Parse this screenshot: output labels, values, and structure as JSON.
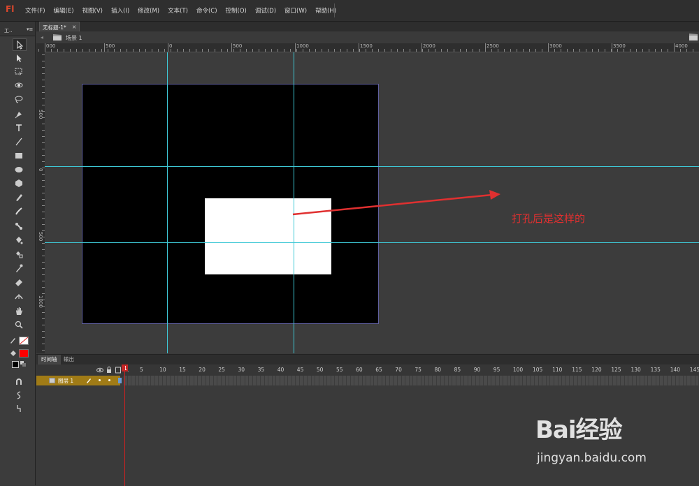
{
  "app": {
    "logo": "Fl"
  },
  "menu": [
    "文件(F)",
    "编辑(E)",
    "视图(V)",
    "插入(I)",
    "修改(M)",
    "文本(T)",
    "命令(C)",
    "控制(O)",
    "调试(D)",
    "窗口(W)",
    "帮助(H)"
  ],
  "toolbar": {
    "title": "工..",
    "menu_glyph": "▾≡"
  },
  "tools": [
    "selection-icon",
    "subselection-icon",
    "free-transform-icon",
    "3d-rotation-icon",
    "lasso-icon",
    "pen-icon",
    "text-icon",
    "line-icon",
    "rectangle-icon",
    "oval-icon",
    "polystar-icon",
    "pencil-icon",
    "brush-icon",
    "bone-icon",
    "paint-bucket-icon",
    "ink-bottle-icon",
    "eyedropper-icon",
    "eraser-icon",
    "width-icon",
    "hand-icon",
    "zoom-icon"
  ],
  "document": {
    "tab_label": "无标题-1*",
    "close": "×"
  },
  "scene": {
    "label": "场景 1",
    "back": "◂"
  },
  "ruler_top_labels": [
    "000",
    "500",
    "0",
    "500",
    "1000",
    "1500",
    "2000",
    "2500",
    "3000",
    "3500",
    "4000"
  ],
  "ruler_left_labels": [
    "500",
    "0",
    "500",
    "1000"
  ],
  "annotation": "打孔后是这样的",
  "colors": {
    "stroke": "#ffffff",
    "fill": "#ff0000",
    "guide": "#3ec8d6",
    "arrow": "#e03030"
  },
  "timeline": {
    "tabs": [
      "时间轴",
      "输出"
    ],
    "frame_numbers": [
      "1",
      "5",
      "10",
      "15",
      "20",
      "25",
      "30",
      "35",
      "40",
      "45",
      "50",
      "55",
      "60",
      "65",
      "70",
      "75",
      "80",
      "85",
      "90",
      "95",
      "100",
      "105",
      "110",
      "115",
      "120",
      "125",
      "130",
      "135",
      "140",
      "145"
    ],
    "layer_name": "图层 1",
    "current_frame": "1"
  },
  "watermark": {
    "logo": "Bai经验",
    "site": "jingyan.baidu.com"
  }
}
